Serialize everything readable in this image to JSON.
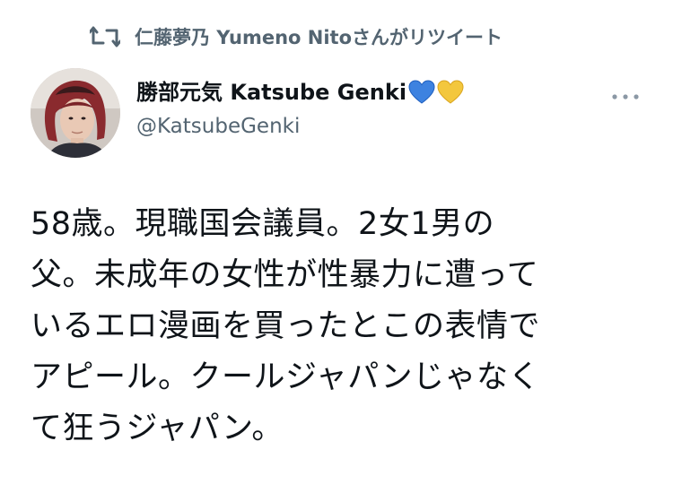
{
  "retweet": {
    "icon": "retweet-icon",
    "text": "仁藤夢乃  Yumeno Nitoさんがリツイート"
  },
  "author": {
    "avatar": "avatar-photo",
    "display_name": "勝部元気 Katsube Genki",
    "emoji": [
      "blue-heart-icon",
      "yellow-heart-icon"
    ],
    "handle": "@KatsubeGenki"
  },
  "more_icon": "more-horizontal-icon",
  "tweet": {
    "lines": [
      "58歳。現職国会議員。2女1男の",
      "父。未成年の女性が性暴力に遭って",
      "いるエロ漫画を買ったとこの表情で",
      "アピール。クールジャパンじゃなく",
      "て狂うジャパン。"
    ]
  },
  "colors": {
    "text": "#0f1419",
    "secondary": "#536471",
    "blue_heart": "#3d82e0",
    "yellow_heart": "#f3c73d"
  }
}
